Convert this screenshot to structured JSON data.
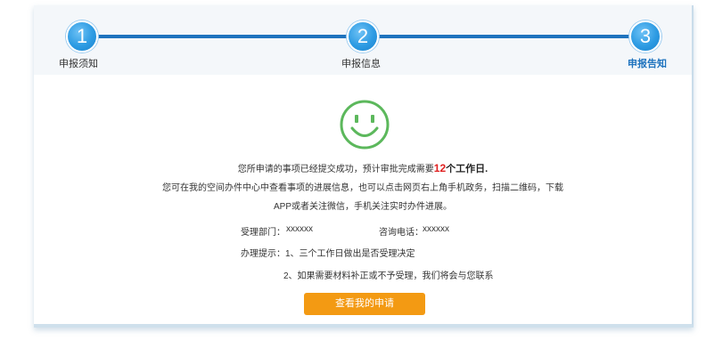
{
  "steps": [
    {
      "number": "1",
      "label": "申报须知"
    },
    {
      "number": "2",
      "label": "申报信息"
    },
    {
      "number": "3",
      "label": "申报告知"
    }
  ],
  "active_step": 3,
  "icons": {
    "success": "smiley-face-icon"
  },
  "colors": {
    "accent": "#1e73be",
    "success": "#5cb85c",
    "days": "#e02020",
    "button": "#f39a13"
  },
  "message": {
    "line1_prefix": "您所申请的事项已经提交成功，预计审批完成需要",
    "days": "12",
    "line1_suffix": "个工作日.",
    "line2": "您可在我的空间办件中心中查看事项的进展信息，也可以点击网页右上角手机政务，扫描二维码，下载",
    "line3": "APP或者关注微信，手机关注实时办件进展。"
  },
  "info": {
    "dept_label": "受理部门：",
    "dept_value": "xxxxxx",
    "phone_label": "咨询电话：",
    "phone_value": "xxxxxx",
    "tips_label": "办理提示：",
    "tip1": "1、三个工作日做出是否受理决定",
    "tip2": "2、如果需要材料补正或不予受理，我们将会与您联系"
  },
  "button": {
    "label": "查看我的申请"
  }
}
